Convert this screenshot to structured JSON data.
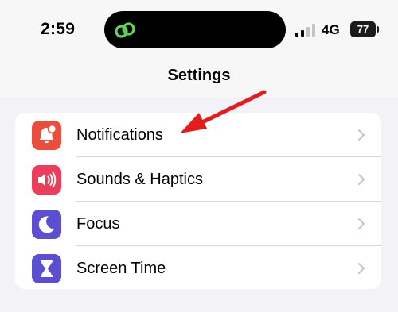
{
  "status_bar": {
    "time": "2:59",
    "network": "4G",
    "battery": "77",
    "island_icon": "link-icon",
    "island_icon_color": "#5ed45e"
  },
  "nav": {
    "title": "Settings"
  },
  "settings": {
    "items": [
      {
        "label": "Notifications",
        "icon": "bell-badge-icon",
        "color": "#eb4d3d"
      },
      {
        "label": "Sounds & Haptics",
        "icon": "speaker-icon",
        "color": "#ec3e5a"
      },
      {
        "label": "Focus",
        "icon": "moon-icon",
        "color": "#5b4fcf"
      },
      {
        "label": "Screen Time",
        "icon": "hourglass-icon",
        "color": "#5b4fcf"
      }
    ]
  },
  "annotation": {
    "arrow_color": "#e11d1d",
    "arrow_target": "Notifications"
  }
}
